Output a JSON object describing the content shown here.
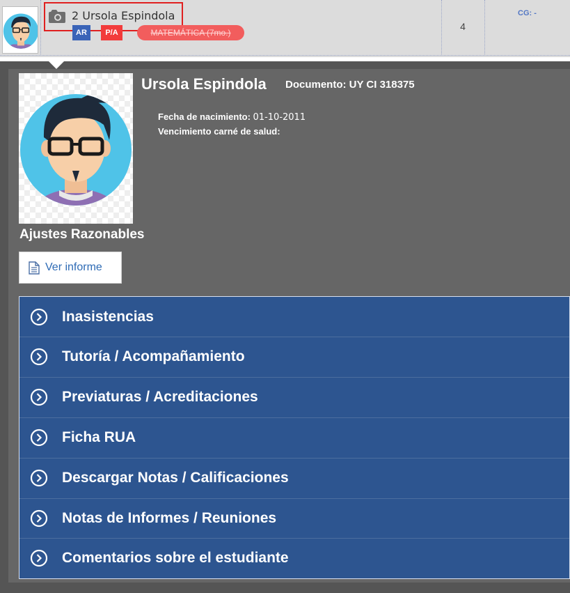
{
  "student_row": {
    "name": "2 Ursola Espindola",
    "badges": {
      "ar": "AR",
      "pa": "P/A",
      "subject": "MATEMÁTICA (7mo.)"
    },
    "count": "4",
    "cg": "CG: -"
  },
  "profile": {
    "full_name": "Ursola Espindola",
    "document": "Documento: UY CI 318375",
    "birth_label": "Fecha de nacimiento:",
    "birth_value": "01-10-2011",
    "health_label": "Vencimiento carné de salud:",
    "ajustes_title": "Ajustes Razonables",
    "ver_informe_label": "Ver informe"
  },
  "menu": {
    "items": [
      {
        "label": "Inasistencias"
      },
      {
        "label": "Tutoría / Acompañamiento"
      },
      {
        "label": "Previaturas / Acreditaciones"
      },
      {
        "label": "Ficha RUA"
      },
      {
        "label": "Descargar Notas / Calificaciones"
      },
      {
        "label": "Notas de Informes / Reuniones"
      },
      {
        "label": "Comentarios sobre el estudiante"
      }
    ]
  },
  "icons": {
    "camera": "camera-icon",
    "document": "document-icon",
    "chevron": "chevron-right-circle-icon",
    "avatar": "avatar-icon"
  },
  "colors": {
    "menu_bg": "#2d5590",
    "panel_bg": "#666666",
    "highlight_box": "#e02020",
    "badge_ar": "#3a64b8",
    "badge_pa": "#f23b3b",
    "badge_subject": "#f25d5d"
  }
}
